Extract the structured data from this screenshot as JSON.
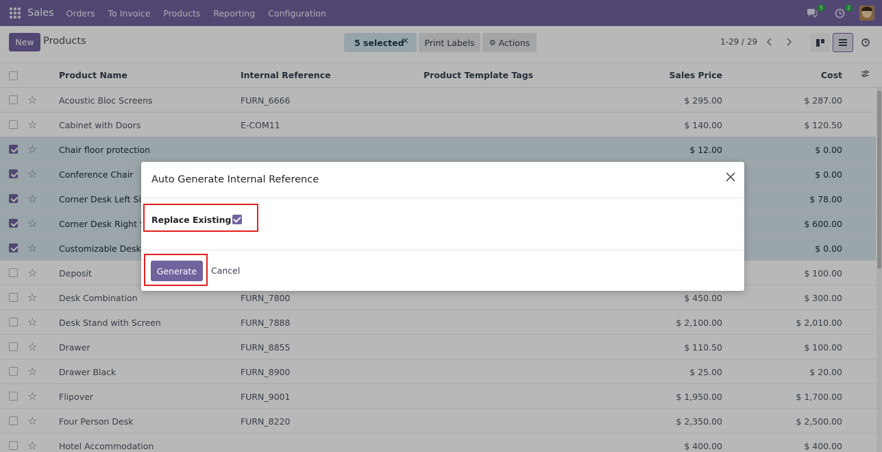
{
  "navbar": {
    "app_name": "Sales",
    "menu": [
      "Orders",
      "To Invoice",
      "Products",
      "Reporting",
      "Configuration"
    ],
    "messages_badge": "5",
    "activities_badge": "2",
    "icons": {
      "apps": "apps-grid-icon",
      "messages": "chat-icon",
      "activities": "clock-icon"
    }
  },
  "control_panel": {
    "new_label": "New",
    "title": "Products",
    "selected_label": "5 selected",
    "print_labels": "Print Labels",
    "actions": "Actions",
    "pager": "1-29 / 29"
  },
  "columns": {
    "name": "Product Name",
    "ref": "Internal Reference",
    "tags": "Product Template Tags",
    "price": "Sales Price",
    "cost": "Cost"
  },
  "rows": [
    {
      "name": "Acoustic Bloc Screens",
      "ref": "FURN_6666",
      "price": "$ 295.00",
      "cost": "$ 287.00",
      "selected": false
    },
    {
      "name": "Cabinet with Doors",
      "ref": "E-COM11",
      "price": "$ 140.00",
      "cost": "$ 120.50",
      "selected": false
    },
    {
      "name": "Chair floor protection",
      "ref": "",
      "price": "$ 12.00",
      "cost": "$ 0.00",
      "selected": true
    },
    {
      "name": "Conference Chair",
      "ref": "",
      "price": "",
      "cost": "$ 0.00",
      "selected": true
    },
    {
      "name": "Corner Desk Left Sit",
      "ref": "",
      "price": "",
      "cost": "$ 78.00",
      "selected": true
    },
    {
      "name": "Corner Desk Right Sit",
      "ref": "",
      "price": "",
      "cost": "$ 600.00",
      "selected": true
    },
    {
      "name": "Customizable Desk",
      "ref": "",
      "price": "",
      "cost": "$ 0.00",
      "selected": true
    },
    {
      "name": "Deposit",
      "ref": "",
      "price": "",
      "cost": "$ 100.00",
      "selected": false
    },
    {
      "name": "Desk Combination",
      "ref": "FURN_7800",
      "price": "$ 450.00",
      "cost": "$ 300.00",
      "selected": false
    },
    {
      "name": "Desk Stand with Screen",
      "ref": "FURN_7888",
      "price": "$ 2,100.00",
      "cost": "$ 2,010.00",
      "selected": false
    },
    {
      "name": "Drawer",
      "ref": "FURN_8855",
      "price": "$ 110.50",
      "cost": "$ 100.00",
      "selected": false
    },
    {
      "name": "Drawer Black",
      "ref": "FURN_8900",
      "price": "$ 25.00",
      "cost": "$ 20.00",
      "selected": false
    },
    {
      "name": "Flipover",
      "ref": "FURN_9001",
      "price": "$ 1,950.00",
      "cost": "$ 1,700.00",
      "selected": false
    },
    {
      "name": "Four Person Desk",
      "ref": "FURN_8220",
      "price": "$ 2,350.00",
      "cost": "$ 2,500.00",
      "selected": false
    },
    {
      "name": "Hotel Accommodation",
      "ref": "",
      "price": "$ 400.00",
      "cost": "$ 400.00",
      "selected": false
    }
  ],
  "modal": {
    "title": "Auto Generate Internal Reference",
    "field_label": "Replace Existing ?",
    "field_checked": true,
    "generate_label": "Generate",
    "cancel_label": "Cancel"
  },
  "colors": {
    "brand": "#71639e",
    "selected_row": "#d6e7ec",
    "highlight": "#e0211c"
  }
}
